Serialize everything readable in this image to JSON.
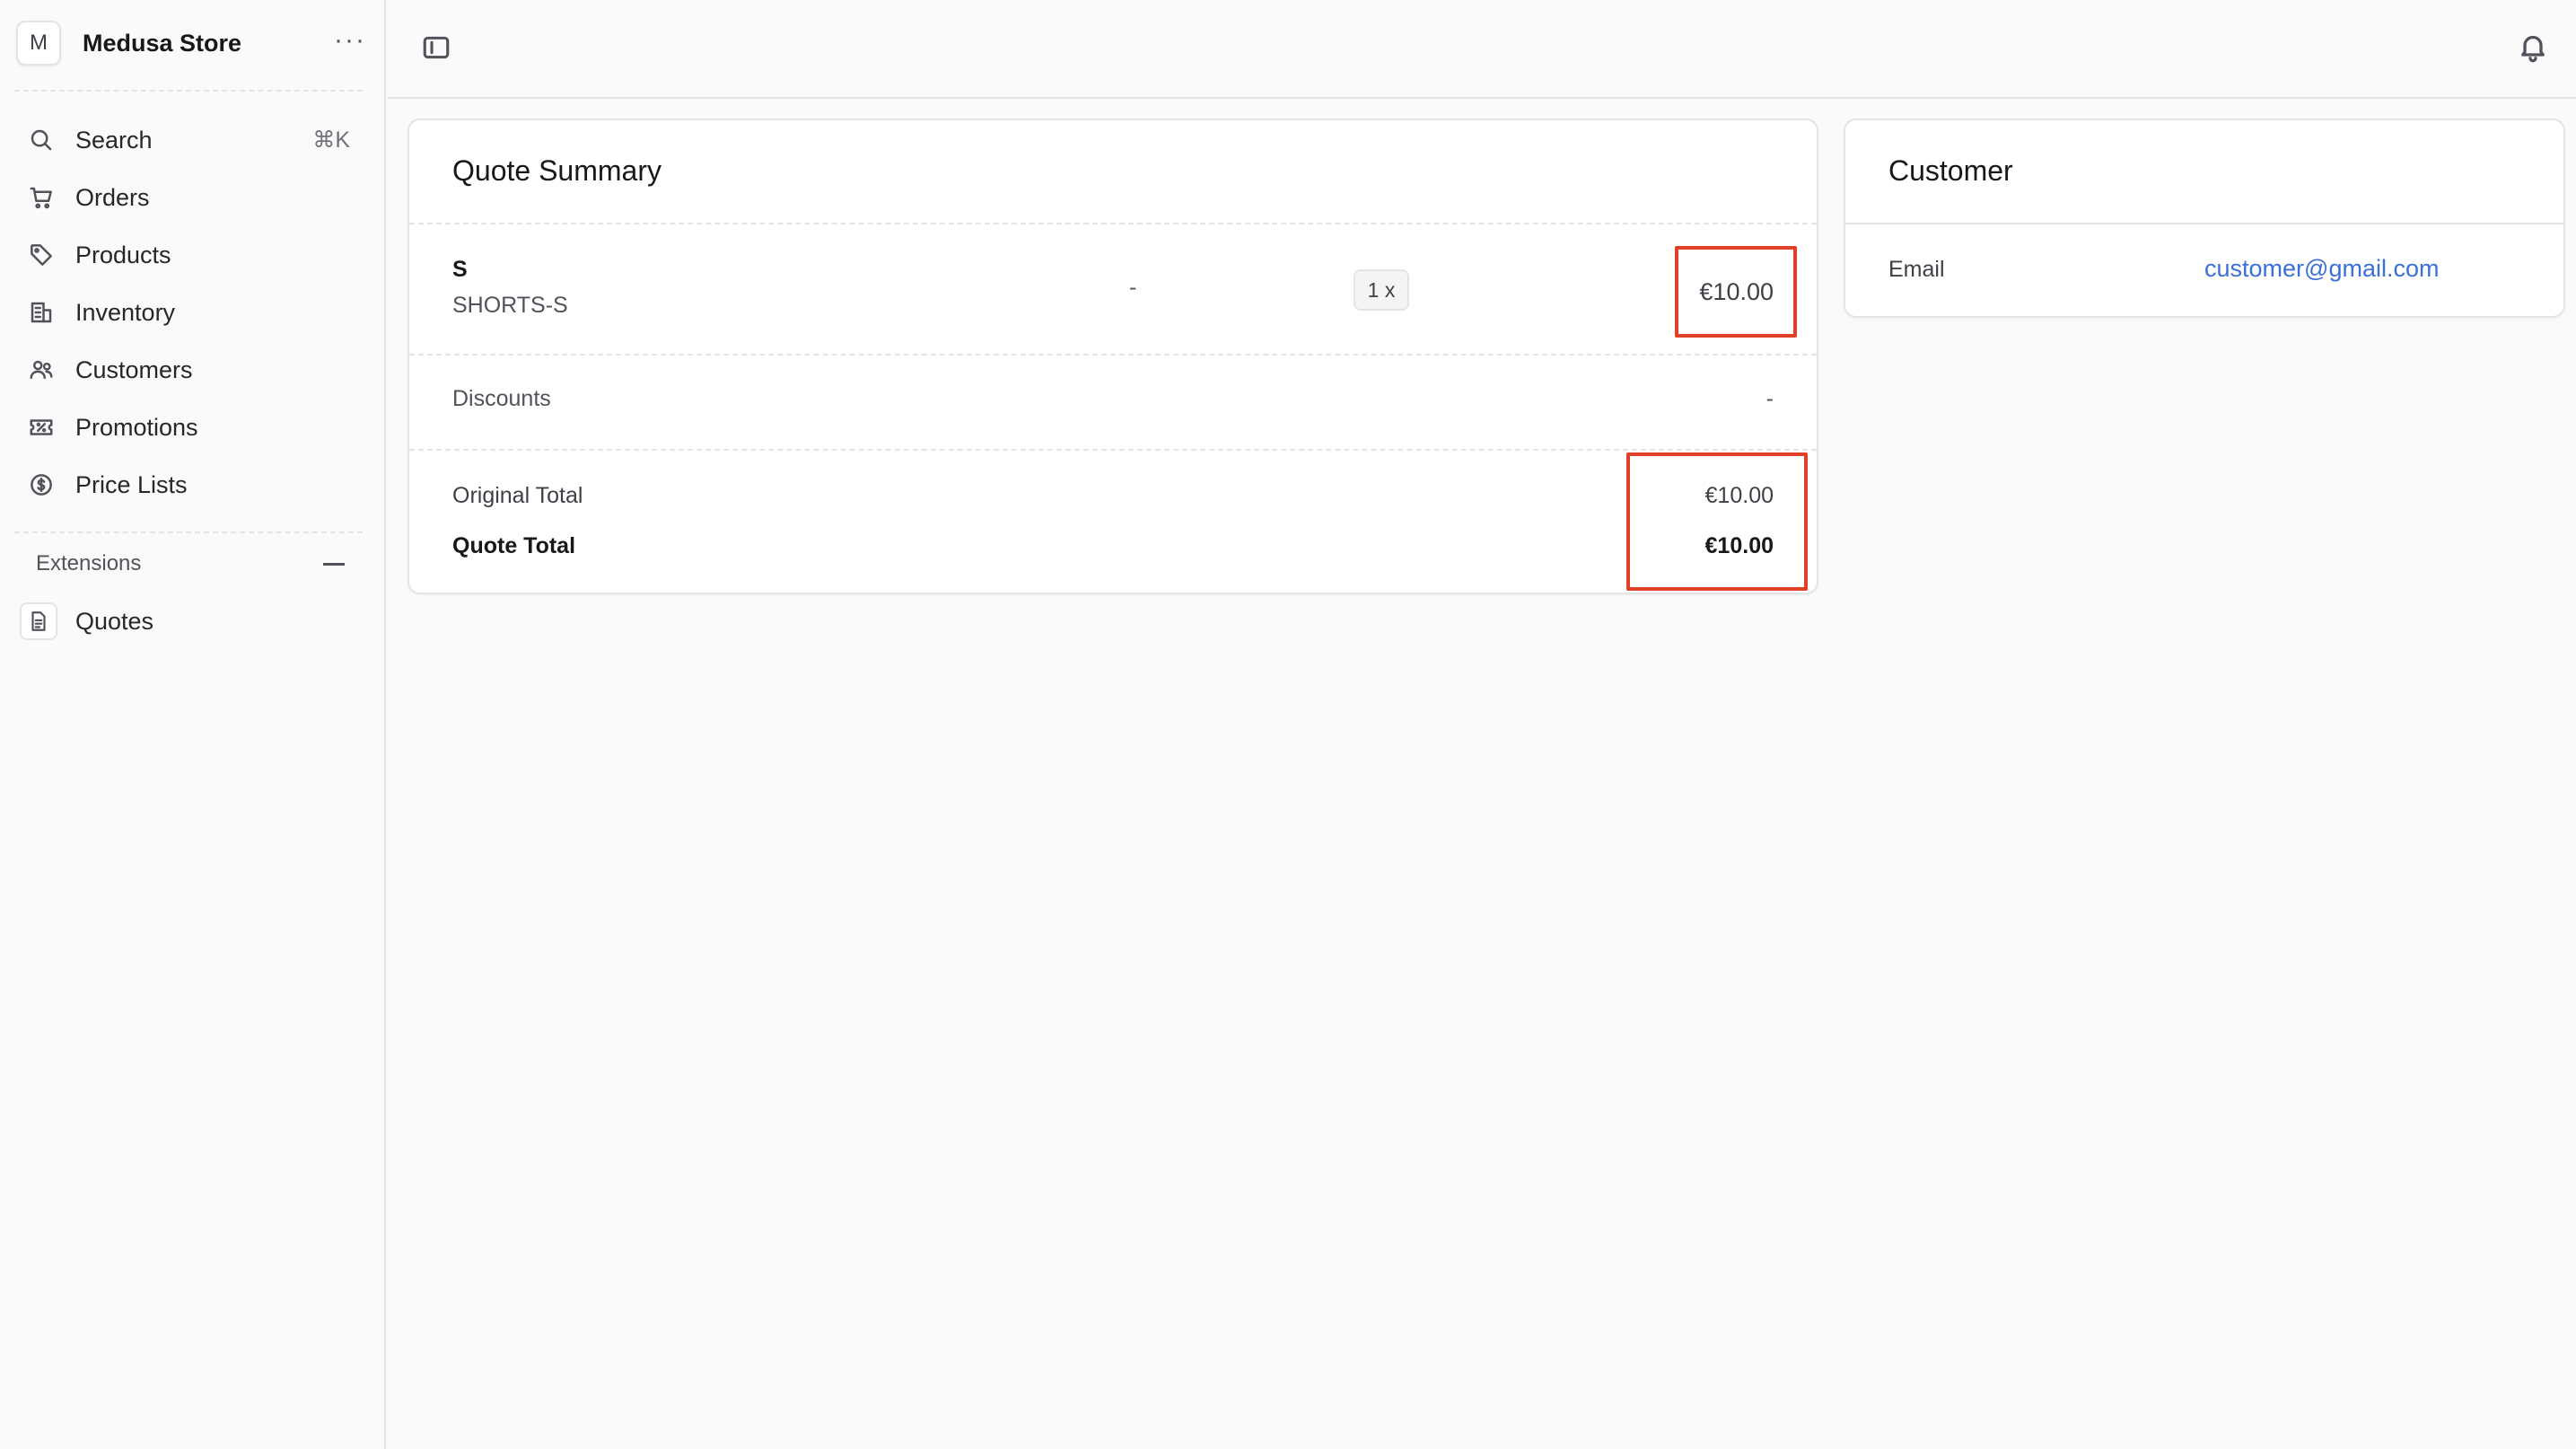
{
  "sidebar": {
    "store": {
      "avatar_letter": "M",
      "name": "Medusa Store",
      "more": "···"
    },
    "items": [
      {
        "label": "Search",
        "icon": "search-icon",
        "shortcut": "⌘K"
      },
      {
        "label": "Orders",
        "icon": "cart-icon"
      },
      {
        "label": "Products",
        "icon": "tag-icon"
      },
      {
        "label": "Inventory",
        "icon": "buildings-icon"
      },
      {
        "label": "Customers",
        "icon": "users-icon"
      },
      {
        "label": "Promotions",
        "icon": "receipt-percent-icon"
      },
      {
        "label": "Price Lists",
        "icon": "currency-dollar-icon"
      }
    ],
    "extensions": {
      "heading": "Extensions",
      "items": [
        {
          "label": "Quotes",
          "icon": "document-icon"
        }
      ]
    }
  },
  "topbar": {
    "toggle_icon": "sidebar-toggle-icon",
    "bell_icon": "bell-icon"
  },
  "quote_summary": {
    "title": "Quote Summary",
    "line_item": {
      "title": "S",
      "sku": "SHORTS-S",
      "variant": "-",
      "quantity": "1 x",
      "price": "€10.00"
    },
    "discounts": {
      "label": "Discounts",
      "value": "-"
    },
    "original_total": {
      "label": "Original Total",
      "value": "€10.00"
    },
    "quote_total": {
      "label": "Quote Total",
      "value": "€10.00"
    }
  },
  "customer": {
    "title": "Customer",
    "email_label": "Email",
    "email_value": "customer@gmail.com"
  },
  "colors": {
    "highlight": "#e0402a",
    "link": "#3b6fd9"
  }
}
